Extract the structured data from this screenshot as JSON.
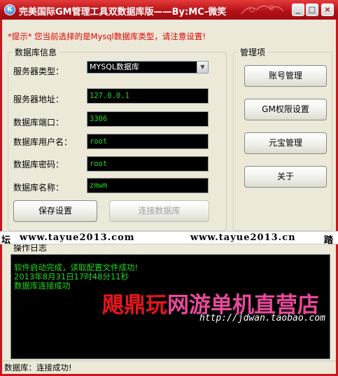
{
  "window": {
    "title": "完美国际GM管理工具双数据库版——By:MC-微笑",
    "icon": "app-logo-icon",
    "controls": {
      "minimize": "_",
      "maximize": "□",
      "close": "×"
    }
  },
  "hint": "*提示*  您当前选择的是Mysql数据库类型，请注意设置!",
  "db_info": {
    "title": "数据库信息",
    "server_type_label": "服务器类型：",
    "server_type_value": "MYSQL数据库",
    "server_address_label": "服务器地址：",
    "server_address_value": "127.0.0.1",
    "port_label": "数据库端口：",
    "port_value": "3306",
    "username_label": "数据库用户名：",
    "username_value": "root",
    "password_label": "数据库密码：",
    "password_value": "root",
    "dbname_label": "数据库名称：",
    "dbname_value": "zmwm",
    "save_button": "保存设置",
    "connect_button": "连接数据库"
  },
  "management": {
    "title": "管理项",
    "buttons": [
      "账号管理",
      "GM权限设置",
      "元宝管理",
      "关于"
    ]
  },
  "log": {
    "title": "操作日志",
    "lines": [
      "软件启动完成，读取配置文件成功!",
      "2013年8月31日17时48分11秒",
      "数据库连接成功"
    ]
  },
  "status_bar": "数据库：连接成功!",
  "watermark": {
    "strip_left": "坛",
    "strip_url1": "www.tayue2013.com",
    "strip_url2": "www.tayue2013.cn",
    "strip_right": "踏",
    "ad_part1": "飓鼎玩",
    "ad_part2": "网游单机直营店",
    "ad_url": "http://jdwan.taobao.com"
  },
  "colors": {
    "frame": "#c8161d",
    "field_bg": "#000000",
    "field_text": "#22d822",
    "hint": "#e00000"
  }
}
